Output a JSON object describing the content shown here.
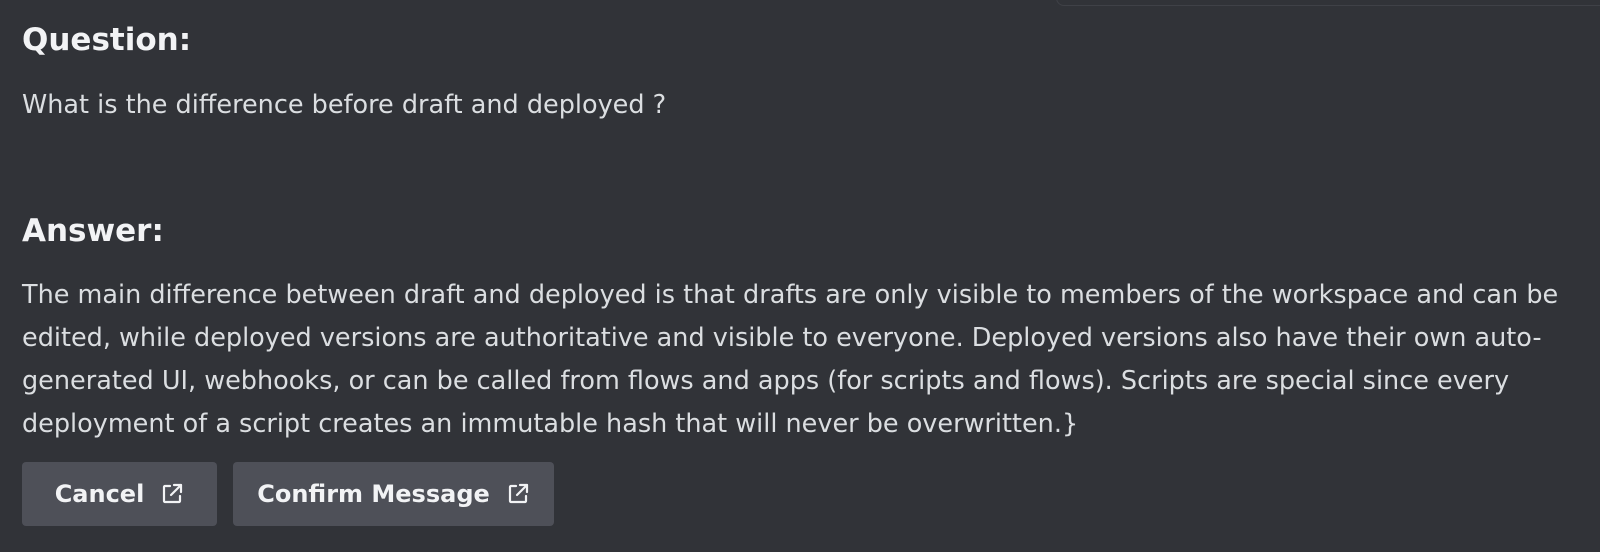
{
  "question": {
    "heading": "Question:",
    "text": "What is the difference before draft and deployed ?"
  },
  "answer": {
    "heading": "Answer:",
    "text": "The main difference between draft and deployed is that drafts are only visible to members of the workspace and can be edited, while deployed versions are authoritative and visible to everyone. Deployed versions also have their own auto-generated UI, webhooks, or can be called from flows and apps (for scripts and flows). Scripts are special since every deployment of a script creates an immutable hash that will never be overwritten.}"
  },
  "buttons": {
    "cancel_label": "Cancel",
    "cancel_icon": "external-link-icon",
    "confirm_label": "Confirm Message",
    "confirm_icon": "external-link-icon"
  },
  "colors": {
    "background": "#313338",
    "button_background": "#4e5058",
    "heading_text": "#f2f3f5",
    "body_text": "#dbdee1"
  }
}
